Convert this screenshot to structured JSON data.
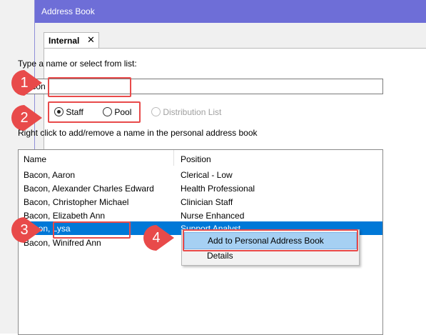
{
  "window": {
    "title": "Address Book"
  },
  "tab": {
    "label": "Internal",
    "close_glyph": "✕"
  },
  "search": {
    "prompt": "Type a name or select from list:",
    "value": "bacon"
  },
  "radio_options": [
    {
      "label": "Staff",
      "selected": true,
      "enabled": true
    },
    {
      "label": "Pool",
      "selected": false,
      "enabled": true
    },
    {
      "label": "Distribution List",
      "selected": false,
      "enabled": false
    }
  ],
  "hint": "Right click to add/remove a name in the personal address book",
  "list": {
    "columns": [
      "Name",
      "Position"
    ],
    "rows": [
      {
        "name": "Bacon, Aaron",
        "position": "Clerical - Low"
      },
      {
        "name": "Bacon, Alexander Charles Edward",
        "position": "Health Professional"
      },
      {
        "name": "Bacon, Christopher Michael",
        "position": "Clinician Staff"
      },
      {
        "name": "Bacon, Elizabeth Ann",
        "position": "Nurse Enhanced"
      },
      {
        "name": "Bacon, Lysa",
        "position": "Support Analyst"
      },
      {
        "name": "Bacon, Winifred Ann",
        "position": ""
      }
    ],
    "selected_index": 4
  },
  "context_menu": {
    "items": [
      "Add to Personal Address Book",
      "Details"
    ],
    "highlighted_index": 0
  },
  "callouts": [
    "1",
    "2",
    "3",
    "4"
  ],
  "colors": {
    "titlebar": "#6e6ed7",
    "selection": "#0078d7",
    "menu_highlight": "#a6d0f3",
    "callout": "#e84a4a"
  }
}
